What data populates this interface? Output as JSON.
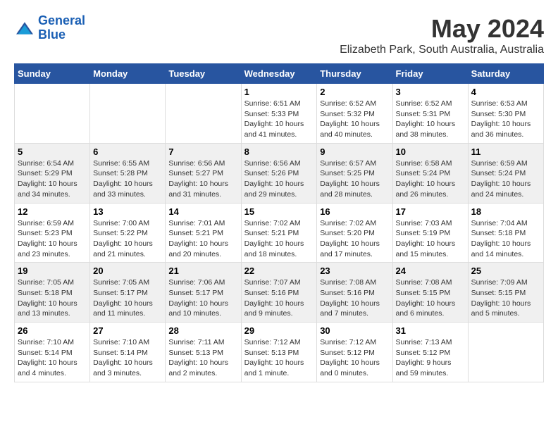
{
  "logo": {
    "line1": "General",
    "line2": "Blue"
  },
  "title": "May 2024",
  "subtitle": "Elizabeth Park, South Australia, Australia",
  "days_of_week": [
    "Sunday",
    "Monday",
    "Tuesday",
    "Wednesday",
    "Thursday",
    "Friday",
    "Saturday"
  ],
  "weeks": [
    {
      "days": [
        {
          "num": "",
          "info": ""
        },
        {
          "num": "",
          "info": ""
        },
        {
          "num": "",
          "info": ""
        },
        {
          "num": "1",
          "info": "Sunrise: 6:51 AM\nSunset: 5:33 PM\nDaylight: 10 hours\nand 41 minutes."
        },
        {
          "num": "2",
          "info": "Sunrise: 6:52 AM\nSunset: 5:32 PM\nDaylight: 10 hours\nand 40 minutes."
        },
        {
          "num": "3",
          "info": "Sunrise: 6:52 AM\nSunset: 5:31 PM\nDaylight: 10 hours\nand 38 minutes."
        },
        {
          "num": "4",
          "info": "Sunrise: 6:53 AM\nSunset: 5:30 PM\nDaylight: 10 hours\nand 36 minutes."
        }
      ]
    },
    {
      "days": [
        {
          "num": "5",
          "info": "Sunrise: 6:54 AM\nSunset: 5:29 PM\nDaylight: 10 hours\nand 34 minutes."
        },
        {
          "num": "6",
          "info": "Sunrise: 6:55 AM\nSunset: 5:28 PM\nDaylight: 10 hours\nand 33 minutes."
        },
        {
          "num": "7",
          "info": "Sunrise: 6:56 AM\nSunset: 5:27 PM\nDaylight: 10 hours\nand 31 minutes."
        },
        {
          "num": "8",
          "info": "Sunrise: 6:56 AM\nSunset: 5:26 PM\nDaylight: 10 hours\nand 29 minutes."
        },
        {
          "num": "9",
          "info": "Sunrise: 6:57 AM\nSunset: 5:25 PM\nDaylight: 10 hours\nand 28 minutes."
        },
        {
          "num": "10",
          "info": "Sunrise: 6:58 AM\nSunset: 5:24 PM\nDaylight: 10 hours\nand 26 minutes."
        },
        {
          "num": "11",
          "info": "Sunrise: 6:59 AM\nSunset: 5:24 PM\nDaylight: 10 hours\nand 24 minutes."
        }
      ]
    },
    {
      "days": [
        {
          "num": "12",
          "info": "Sunrise: 6:59 AM\nSunset: 5:23 PM\nDaylight: 10 hours\nand 23 minutes."
        },
        {
          "num": "13",
          "info": "Sunrise: 7:00 AM\nSunset: 5:22 PM\nDaylight: 10 hours\nand 21 minutes."
        },
        {
          "num": "14",
          "info": "Sunrise: 7:01 AM\nSunset: 5:21 PM\nDaylight: 10 hours\nand 20 minutes."
        },
        {
          "num": "15",
          "info": "Sunrise: 7:02 AM\nSunset: 5:21 PM\nDaylight: 10 hours\nand 18 minutes."
        },
        {
          "num": "16",
          "info": "Sunrise: 7:02 AM\nSunset: 5:20 PM\nDaylight: 10 hours\nand 17 minutes."
        },
        {
          "num": "17",
          "info": "Sunrise: 7:03 AM\nSunset: 5:19 PM\nDaylight: 10 hours\nand 15 minutes."
        },
        {
          "num": "18",
          "info": "Sunrise: 7:04 AM\nSunset: 5:18 PM\nDaylight: 10 hours\nand 14 minutes."
        }
      ]
    },
    {
      "days": [
        {
          "num": "19",
          "info": "Sunrise: 7:05 AM\nSunset: 5:18 PM\nDaylight: 10 hours\nand 13 minutes."
        },
        {
          "num": "20",
          "info": "Sunrise: 7:05 AM\nSunset: 5:17 PM\nDaylight: 10 hours\nand 11 minutes."
        },
        {
          "num": "21",
          "info": "Sunrise: 7:06 AM\nSunset: 5:17 PM\nDaylight: 10 hours\nand 10 minutes."
        },
        {
          "num": "22",
          "info": "Sunrise: 7:07 AM\nSunset: 5:16 PM\nDaylight: 10 hours\nand 9 minutes."
        },
        {
          "num": "23",
          "info": "Sunrise: 7:08 AM\nSunset: 5:16 PM\nDaylight: 10 hours\nand 7 minutes."
        },
        {
          "num": "24",
          "info": "Sunrise: 7:08 AM\nSunset: 5:15 PM\nDaylight: 10 hours\nand 6 minutes."
        },
        {
          "num": "25",
          "info": "Sunrise: 7:09 AM\nSunset: 5:15 PM\nDaylight: 10 hours\nand 5 minutes."
        }
      ]
    },
    {
      "days": [
        {
          "num": "26",
          "info": "Sunrise: 7:10 AM\nSunset: 5:14 PM\nDaylight: 10 hours\nand 4 minutes."
        },
        {
          "num": "27",
          "info": "Sunrise: 7:10 AM\nSunset: 5:14 PM\nDaylight: 10 hours\nand 3 minutes."
        },
        {
          "num": "28",
          "info": "Sunrise: 7:11 AM\nSunset: 5:13 PM\nDaylight: 10 hours\nand 2 minutes."
        },
        {
          "num": "29",
          "info": "Sunrise: 7:12 AM\nSunset: 5:13 PM\nDaylight: 10 hours\nand 1 minute."
        },
        {
          "num": "30",
          "info": "Sunrise: 7:12 AM\nSunset: 5:12 PM\nDaylight: 10 hours\nand 0 minutes."
        },
        {
          "num": "31",
          "info": "Sunrise: 7:13 AM\nSunset: 5:12 PM\nDaylight: 9 hours\nand 59 minutes."
        },
        {
          "num": "",
          "info": ""
        }
      ]
    }
  ]
}
